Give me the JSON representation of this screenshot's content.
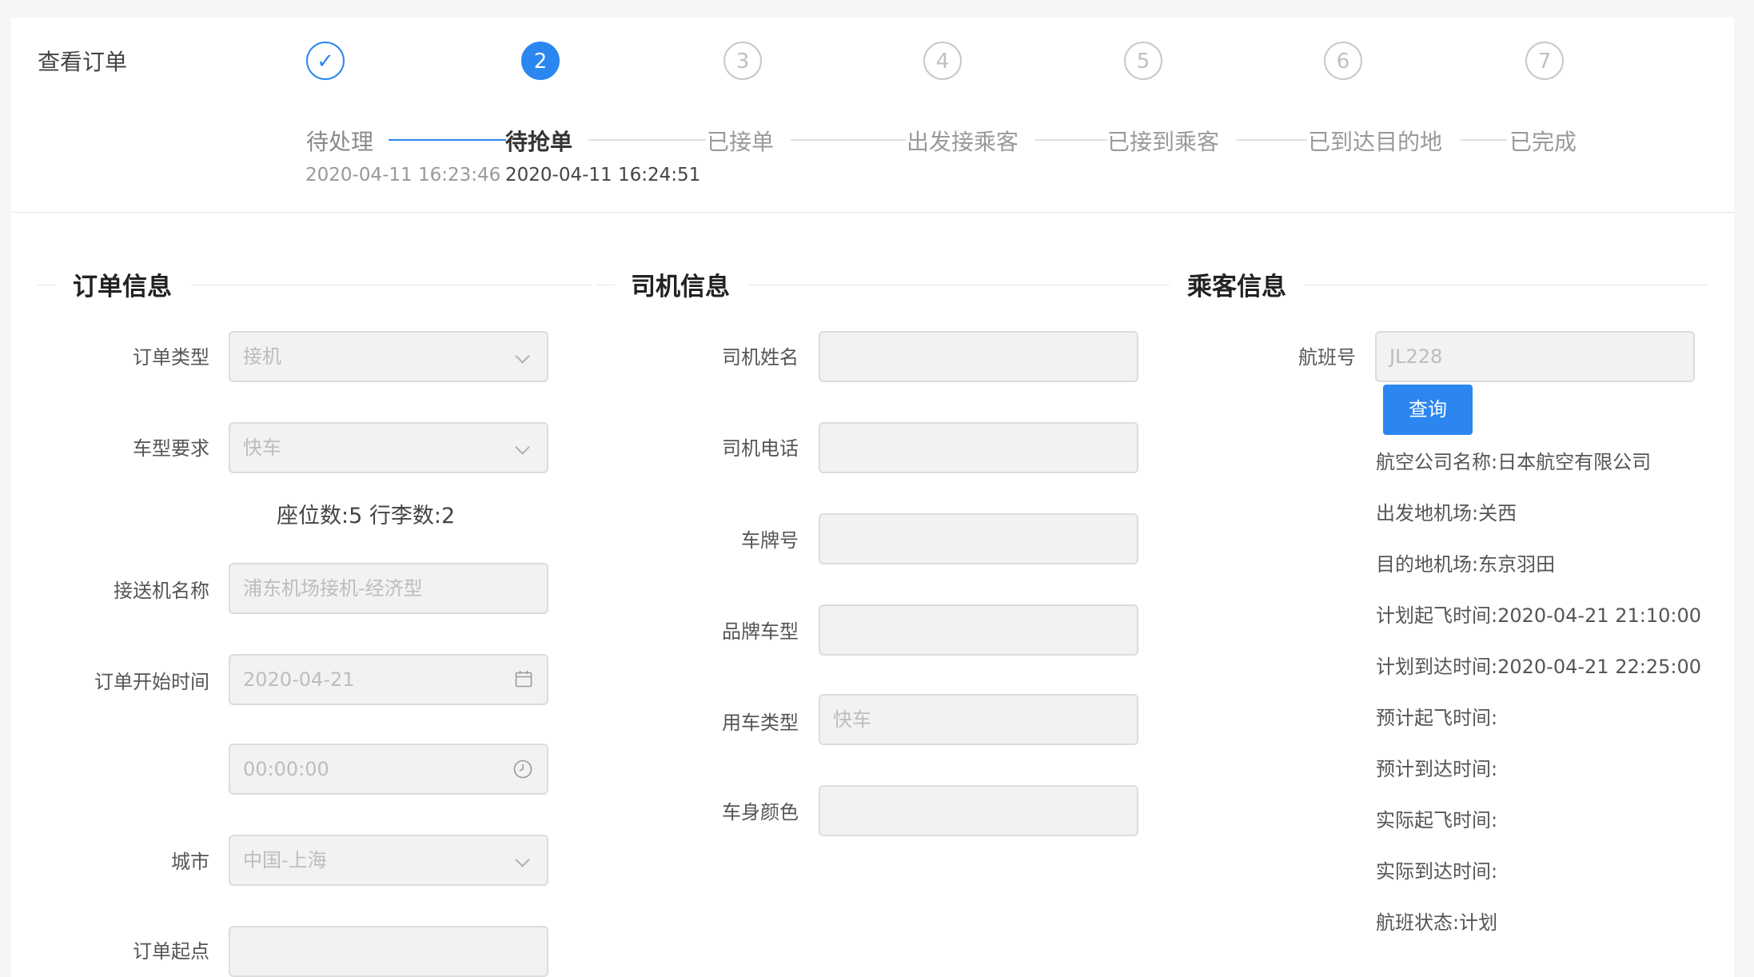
{
  "page": {
    "title": "查看订单"
  },
  "steps": [
    {
      "num": "✓",
      "title": "待处理",
      "time": "2020-04-11 16:23:46",
      "state": "done"
    },
    {
      "num": "2",
      "title": "待抢单",
      "time": "2020-04-11 16:24:51",
      "state": "active"
    },
    {
      "num": "3",
      "title": "已接单",
      "time": "",
      "state": "wait"
    },
    {
      "num": "4",
      "title": "出发接乘客",
      "time": "",
      "state": "wait"
    },
    {
      "num": "5",
      "title": "已接到乘客",
      "time": "",
      "state": "wait"
    },
    {
      "num": "6",
      "title": "已到达目的地",
      "time": "",
      "state": "wait"
    },
    {
      "num": "7",
      "title": "已完成",
      "time": "",
      "state": "wait"
    }
  ],
  "order_info": {
    "title": "订单信息",
    "order_type": {
      "label": "订单类型",
      "value": "接机"
    },
    "car_type": {
      "label": "车型要求",
      "value": "快车"
    },
    "seat_text": "座位数:5   行李数:2",
    "transfer_name": {
      "label": "接送机名称",
      "value": "浦东机场接机-经济型"
    },
    "start_time": {
      "label": "订单开始时间",
      "date": "2020-04-21",
      "time": "00:00:00"
    },
    "city": {
      "label": "城市",
      "value": "中国-上海"
    },
    "start_point": {
      "label": "订单起点"
    }
  },
  "driver_info": {
    "title": "司机信息",
    "name": {
      "label": "司机姓名",
      "value": ""
    },
    "phone": {
      "label": "司机电话",
      "value": ""
    },
    "plate": {
      "label": "车牌号",
      "value": ""
    },
    "brand": {
      "label": "品牌车型",
      "value": ""
    },
    "use_type": {
      "label": "用车类型",
      "value": "快车"
    },
    "color": {
      "label": "车身颜色",
      "value": ""
    }
  },
  "passenger_info": {
    "title": "乘客信息",
    "flight": {
      "label": "航班号",
      "value": "JL228"
    },
    "query_label": "查询",
    "lines": [
      "航空公司名称:日本航空有限公司",
      "出发地机场:关西",
      "目的地机场:东京羽田",
      "计划起飞时间:2020-04-21 21:10:00",
      "计划到达时间:2020-04-21 22:25:00",
      "预计起飞时间:",
      "预计到达时间:",
      "实际起飞时间:",
      "实际到达时间:",
      "航班状态:计划"
    ]
  },
  "colors": {
    "accent": "#2b86f0",
    "field_bg": "#f2f2f2",
    "border": "#dcdcdc"
  }
}
